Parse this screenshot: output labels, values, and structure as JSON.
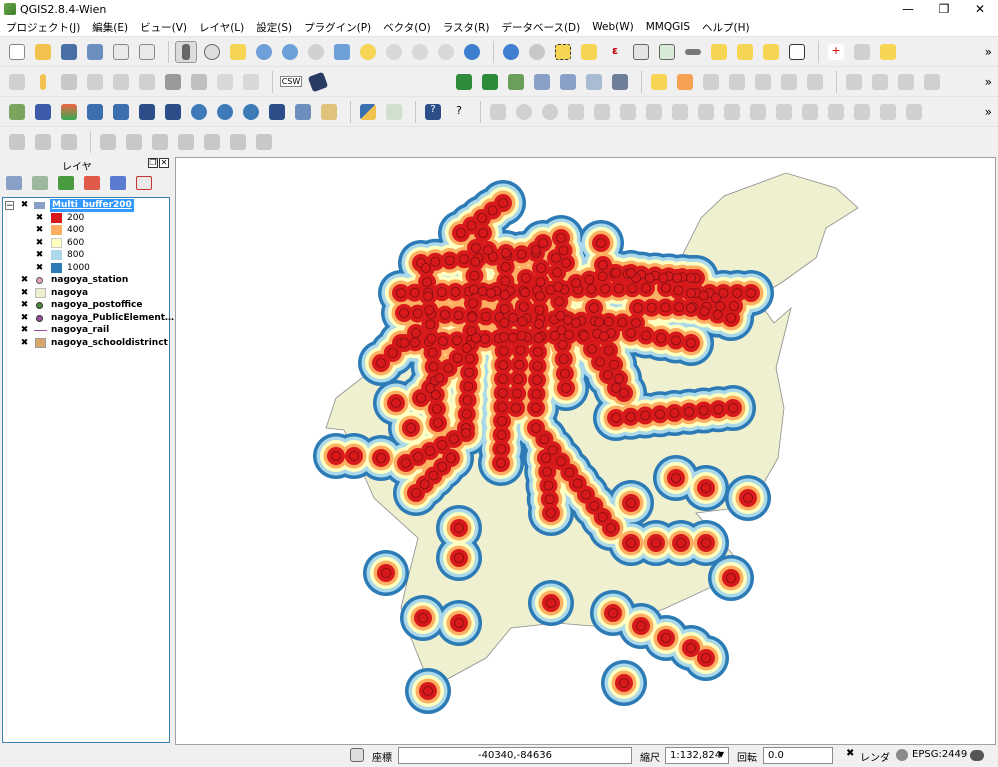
{
  "window": {
    "title": "QGIS2.8.4-Wien",
    "controls": [
      "—",
      "❐",
      "✕"
    ]
  },
  "menu": [
    "プロジェクト(J)",
    "編集(E)",
    "ビュー(V)",
    "レイヤ(L)",
    "設定(S)",
    "プラグイン(P)",
    "ベクタ(O)",
    "ラスタ(R)",
    "データベース(D)",
    "Web(W)",
    "MMQGIS",
    "ヘルプ(H)"
  ],
  "toolbar_labels": {
    "csw": "CSW"
  },
  "layers_panel": {
    "title": "レイヤ",
    "root_layer": "Multi_buffer200",
    "classes": [
      {
        "label": "200",
        "color": "#d7191c"
      },
      {
        "label": "400",
        "color": "#fdae61"
      },
      {
        "label": "600",
        "color": "#ffffbf"
      },
      {
        "label": "800",
        "color": "#abd9e9"
      },
      {
        "label": "1000",
        "color": "#2c7bb6"
      }
    ],
    "layers": [
      {
        "label": "nagoya_station",
        "symbol": "point-pink"
      },
      {
        "label": "nagoya",
        "symbol": "fill-beige"
      },
      {
        "label": "nagoya_postoffice",
        "symbol": "point-green"
      },
      {
        "label": "nagoya_PublicElement…",
        "symbol": "point-purple"
      },
      {
        "label": "nagoya_rail",
        "symbol": "line-purple"
      },
      {
        "label": "nagoya_schooldistrinct",
        "symbol": "fill-tan"
      }
    ]
  },
  "status": {
    "coord_label": "座標",
    "coord_value": "-40340,-84636",
    "scale_label": "縮尺",
    "scale_value": "1:132,824",
    "rotation_label": "回転",
    "rotation_value": "0.0",
    "render_label": "レンダ",
    "crs": "EPSG:2449"
  },
  "map": {
    "land_color": "#eef0cf",
    "ring_colors": [
      "#2c7bb6",
      "#abd9e9",
      "#ffffbf",
      "#fdae61",
      "#d7191c"
    ]
  }
}
